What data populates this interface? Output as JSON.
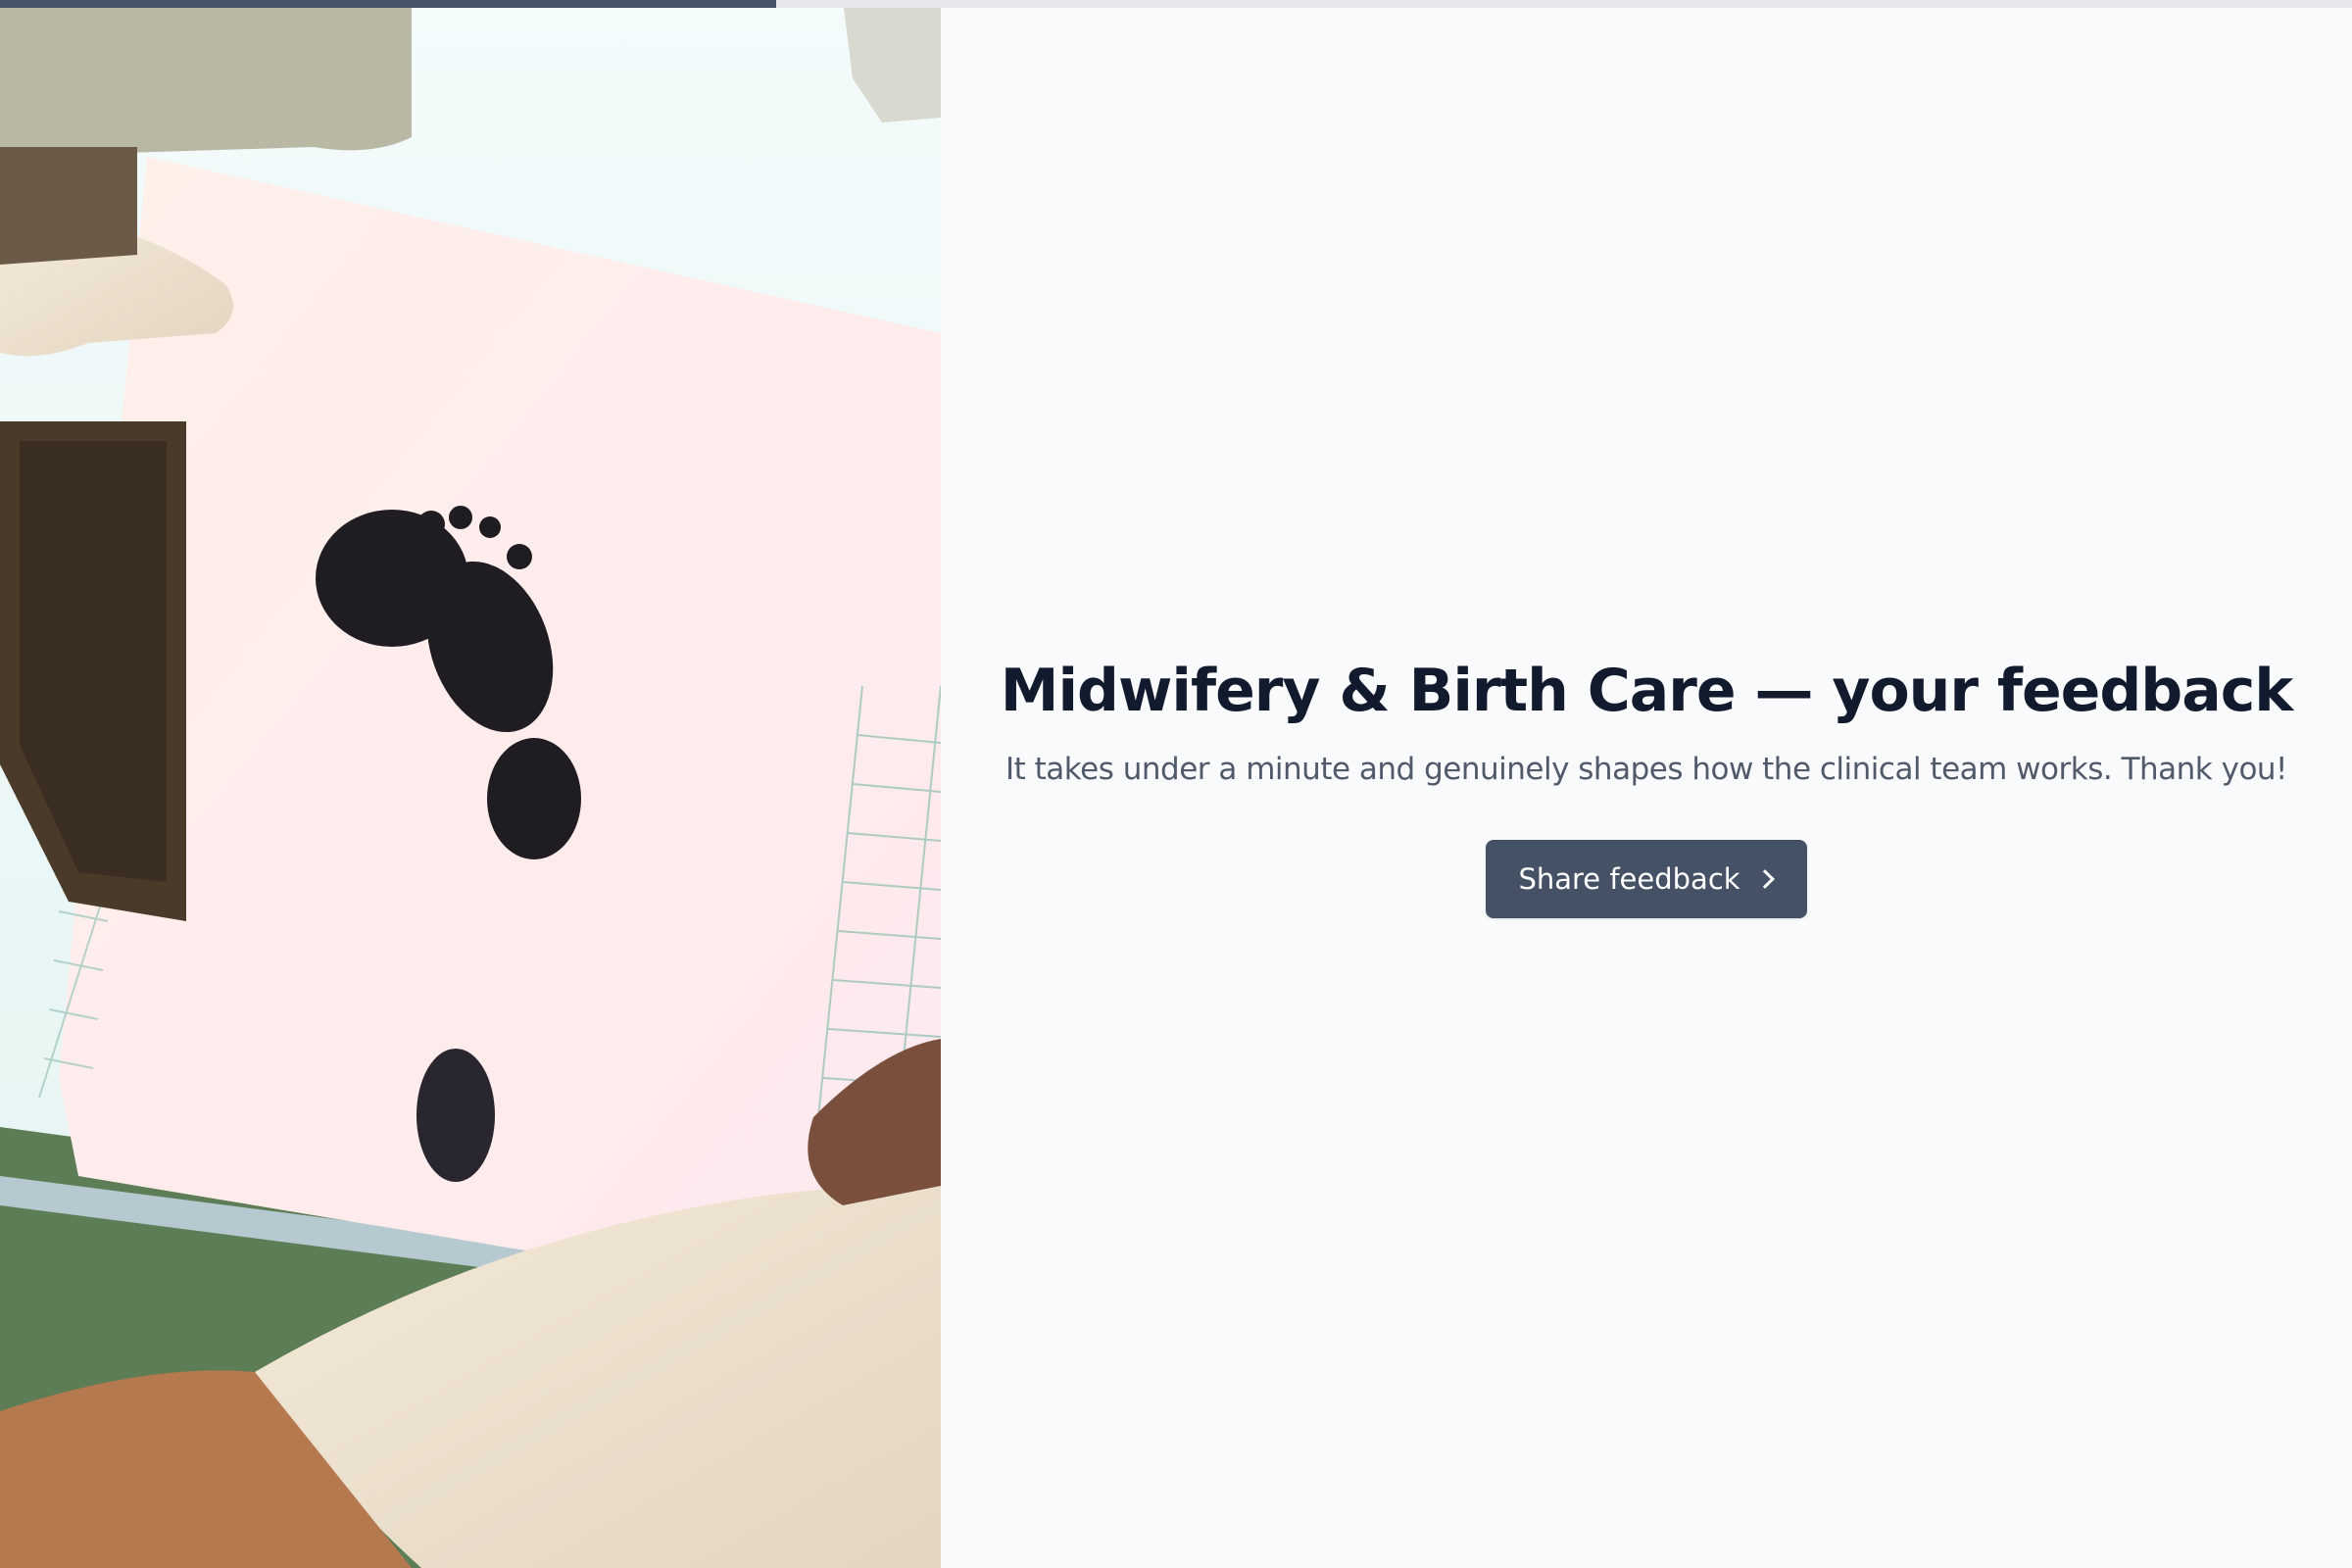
{
  "progress": {
    "fraction": 0.33,
    "fill_color": "#475467",
    "track_color": "#e6e8ec"
  },
  "hero_image": {
    "icon": "baby-footprint-photo"
  },
  "main": {
    "title": "Midwifery & Birth Care — your feedback",
    "subtitle": "It takes under a minute and genuinely shapes how the clinical team works. Thank you!",
    "cta_label": "Share feedback",
    "cta_icon": "chevron-right-icon",
    "button_color": "#455266",
    "background_color": "#f9fafc"
  }
}
